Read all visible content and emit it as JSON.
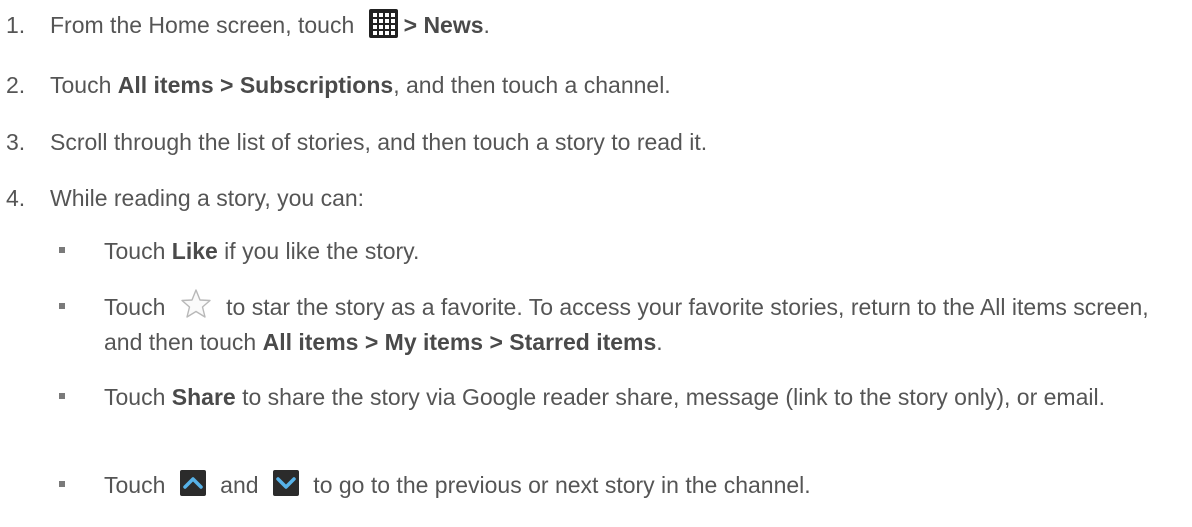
{
  "steps": [
    {
      "number": "1.",
      "parts": [
        "From the Home screen, touch ",
        "> News",
        "."
      ]
    },
    {
      "number": "2.",
      "parts": [
        "Touch ",
        "All items > Subscriptions",
        ", and then touch a channel."
      ]
    },
    {
      "number": "3.",
      "parts": [
        "Scroll through the list of stories, and then touch a story to read it."
      ]
    },
    {
      "number": "4.",
      "parts": [
        "While reading a story, you can:"
      ]
    }
  ],
  "substeps": [
    {
      "parts": [
        "Touch ",
        "Like",
        " if you like the story."
      ]
    },
    {
      "parts": [
        "Touch ",
        " to star the story as a favorite. To access your favorite stories, return to the All items screen, and then touch ",
        "All items > My items > Starred items",
        "."
      ]
    },
    {
      "parts": [
        "Touch ",
        "Share",
        " to share the story via Google reader share, message (link to the story only), or email."
      ]
    },
    {
      "parts": [
        "Touch ",
        " and ",
        " to go to the previous or next story in the channel."
      ]
    }
  ],
  "icons": {
    "apps": "apps-grid-icon",
    "star": "star-icon",
    "previous": "chevron-up-icon",
    "next": "chevron-down-icon"
  },
  "colors": {
    "text": "#555555",
    "bold": "#4a4a4a",
    "apps_icon": "#222222",
    "arrow_button": "#2b2b2b",
    "arrow_glyph": "#57b2e8"
  }
}
